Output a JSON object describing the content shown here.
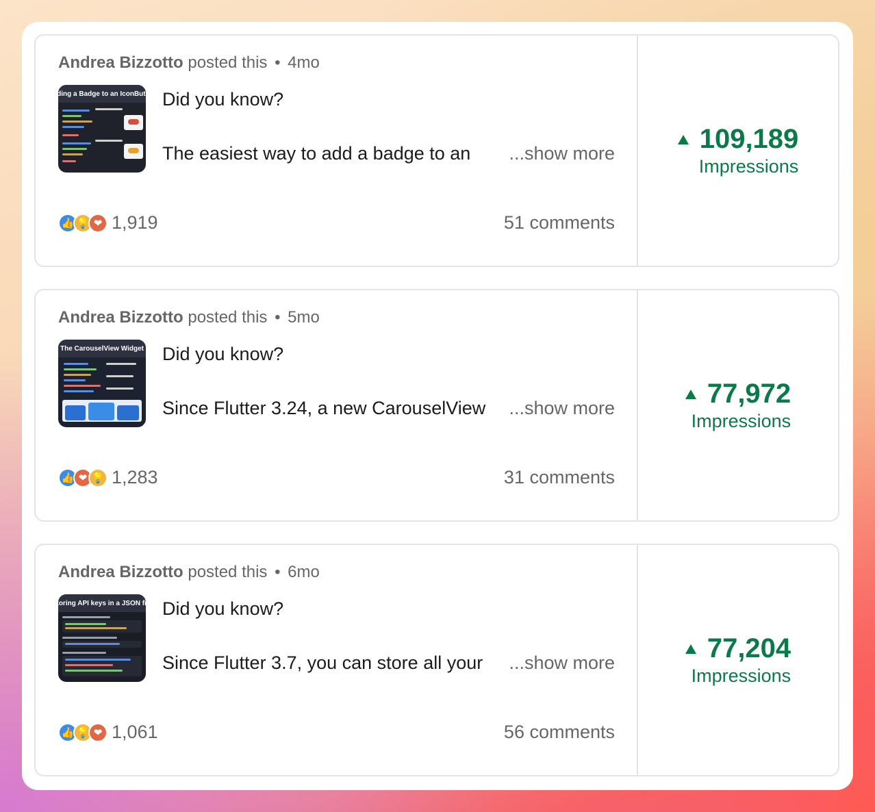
{
  "posts": [
    {
      "author": "Andrea Bizzotto",
      "posted_label": "posted this",
      "age": "4mo",
      "thumbnail_title": "Adding a Badge to an IconButton",
      "headline": "Did you know?",
      "snippet": "The easiest way to add a badge to an",
      "show_more": "...show more",
      "reactions": [
        "like-icon",
        "idea-icon",
        "love-icon"
      ],
      "reaction_count": "1,919",
      "comments": "51 comments",
      "impressions": "109,189",
      "impressions_label": "Impressions"
    },
    {
      "author": "Andrea Bizzotto",
      "posted_label": "posted this",
      "age": "5mo",
      "thumbnail_title": "The CarouselView Widget",
      "headline": "Did you know?",
      "snippet": "Since Flutter 3.24, a new CarouselView",
      "show_more": "...show more",
      "reactions": [
        "like-icon",
        "love-icon",
        "idea-icon"
      ],
      "reaction_count": "1,283",
      "comments": "31 comments",
      "impressions": "77,972",
      "impressions_label": "Impressions"
    },
    {
      "author": "Andrea Bizzotto",
      "posted_label": "posted this",
      "age": "6mo",
      "thumbnail_title": "Storing API keys in a JSON file",
      "headline": "Did you know?",
      "snippet": "Since Flutter 3.7, you can store all your",
      "show_more": "...show more",
      "reactions": [
        "like-icon",
        "idea-icon",
        "love-icon"
      ],
      "reaction_count": "1,061",
      "comments": "56 comments",
      "impressions": "77,204",
      "impressions_label": "Impressions"
    }
  ],
  "colors": {
    "impressions_green": "#0b7a4a",
    "like": "#3a8de6",
    "idea": "#f2b640",
    "love": "#e16745"
  }
}
